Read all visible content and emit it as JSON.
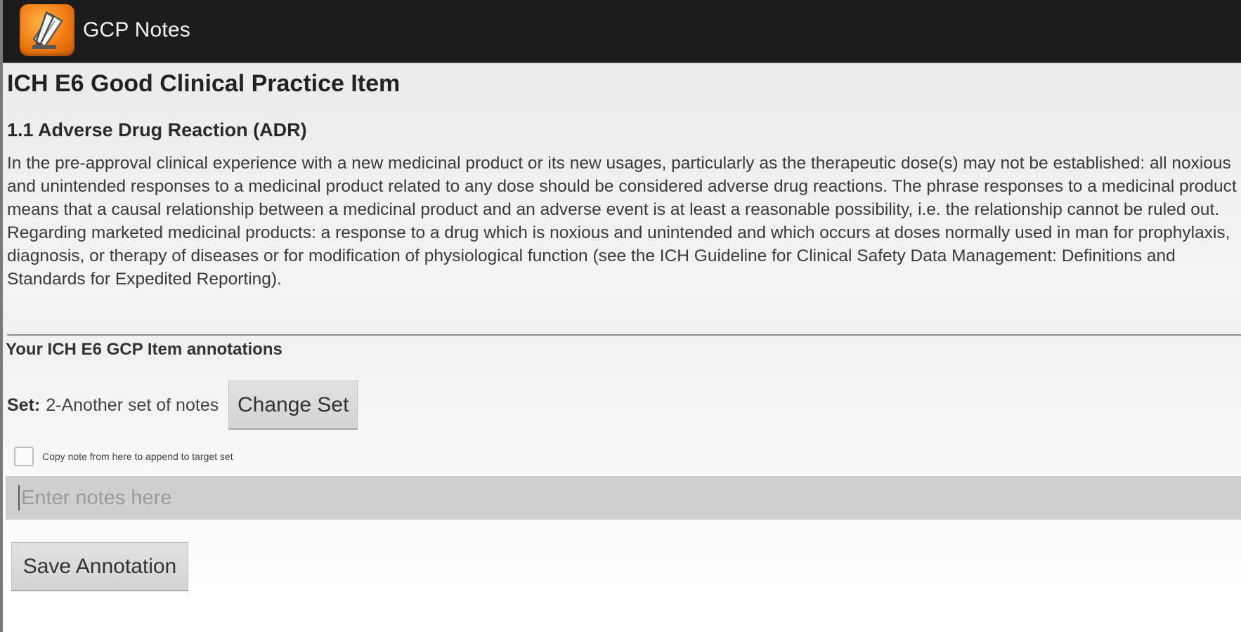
{
  "app": {
    "title": "GCP Notes",
    "icon": "notes-pencil-icon"
  },
  "item": {
    "page_title": "ICH E6 Good Clinical Practice Item",
    "heading": "1.1 Adverse Drug Reaction (ADR)",
    "paragraphs": [
      "In the pre-approval clinical experience with a new medicinal product or its new usages, particularly as the therapeutic dose(s) may not be established: all noxious and unintended responses to a medicinal product related to any dose should be considered adverse drug reactions. The phrase responses to a medicinal product means that a causal relationship between a medicinal product and an adverse event is at least a reasonable possibility, i.e. the relationship cannot be ruled out.",
      "Regarding marketed medicinal products: a response to a drug which is noxious and unintended and which occurs at doses normally used in man for prophylaxis, diagnosis, or therapy of diseases or for modification of physiological function (see the ICH Guideline for Clinical Safety Data Management: Definitions and Standards for Expedited Reporting)."
    ]
  },
  "annotations": {
    "heading": "Your ICH E6 GCP Item annotations",
    "set_label": "Set:",
    "set_value": "2-Another set of notes",
    "change_set_label": "Change Set",
    "copy_checkbox_label": "Copy note from here to append to target set",
    "copy_checked": false,
    "notes_value": "",
    "notes_placeholder": "Enter notes here",
    "save_label": "Save Annotation"
  },
  "colors": {
    "action_bar": "#1c1c1c",
    "icon_orange": "#f07a12",
    "notes_field": "#cfcfcf",
    "button": "#d9d9d9"
  }
}
